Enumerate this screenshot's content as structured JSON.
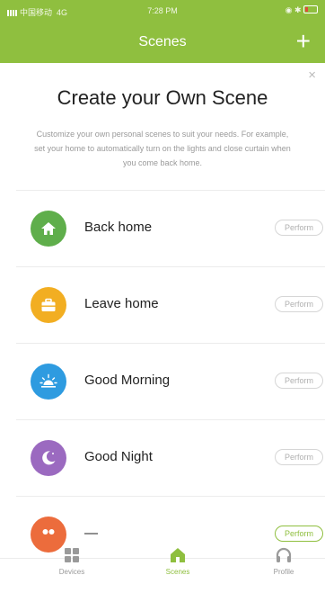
{
  "status_bar": {
    "carrier": "中国移动",
    "network": "4G",
    "time": "7:28 PM"
  },
  "nav": {
    "title": "Scenes",
    "add_symbol": "+"
  },
  "intro": {
    "close_symbol": "×",
    "heading": "Create your Own Scene",
    "description": "Customize your own personal scenes to suit your needs. For example, set your home to automatically turn on the lights and close curtain when you come back home."
  },
  "scenes": [
    {
      "name": "Back home",
      "action": "Perform",
      "icon": "house-icon",
      "color": "#5fae4b"
    },
    {
      "name": "Leave home",
      "action": "Perform",
      "icon": "briefcase-icon",
      "color": "#f2ae22"
    },
    {
      "name": "Good Morning",
      "action": "Perform",
      "icon": "sunrise-icon",
      "color": "#2e9be0"
    },
    {
      "name": "Good Night",
      "action": "Perform",
      "icon": "moon-icon",
      "color": "#9b6ac0"
    },
    {
      "name": "—",
      "action": "Perform",
      "icon": "scene-icon",
      "color": "#ec6c3c"
    }
  ],
  "tabs": [
    {
      "label": "Devices",
      "icon": "grid-icon"
    },
    {
      "label": "Scenes",
      "icon": "house-icon",
      "active": true
    },
    {
      "label": "Profile",
      "icon": "headset-icon"
    }
  ],
  "colors": {
    "brand": "#8fbf3f",
    "status_bar": "#8fbf3f"
  }
}
